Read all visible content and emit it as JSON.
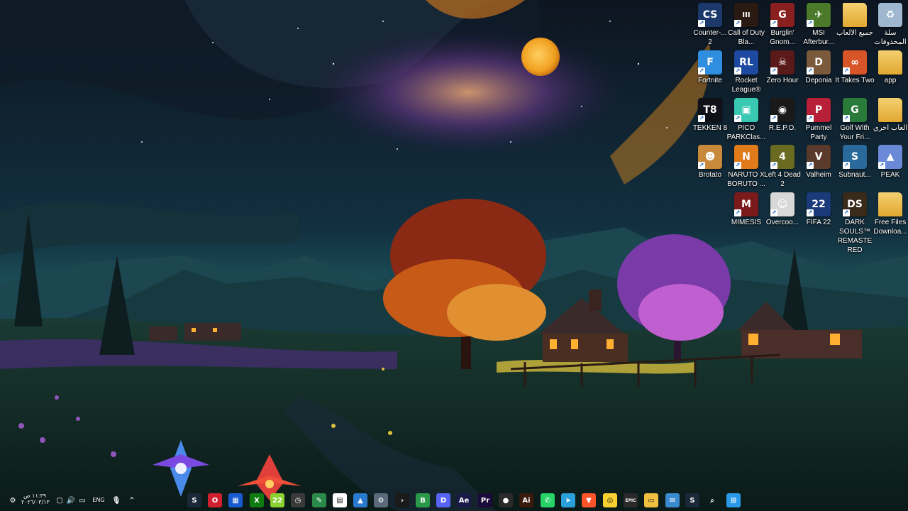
{
  "desktop": {
    "icons": [
      {
        "label": "Counter-...\n2",
        "icon": "counter-strike-icon",
        "color": "#1b3a6b",
        "glyph": "CS",
        "shortcut": true
      },
      {
        "label": "Call of Duty Bla...",
        "icon": "call-of-duty-icon",
        "color": "#2a1a12",
        "glyph": "III",
        "shortcut": true
      },
      {
        "label": "Burglin' Gnom...",
        "icon": "burglin-gnomes-icon",
        "color": "#8a1f1f",
        "glyph": "G",
        "shortcut": true
      },
      {
        "label": "MSI Afterbur...",
        "icon": "msi-afterburner-icon",
        "color": "#4a7a2a",
        "glyph": "✈",
        "shortcut": true
      },
      {
        "label": "جميع الالعاب",
        "icon": "folder-icon",
        "color": "#e8b84a",
        "glyph": "",
        "shortcut": false
      },
      {
        "label": "سلة المحذوفات",
        "icon": "recycle-bin-icon",
        "color": "#9fb8d0",
        "glyph": "♻",
        "shortcut": false
      },
      {
        "label": "Fortnite",
        "icon": "fortnite-icon",
        "color": "#2f8ee0",
        "glyph": "F",
        "shortcut": true
      },
      {
        "label": "Rocket League®",
        "icon": "rocket-league-icon",
        "color": "#1d4aa0",
        "glyph": "RL",
        "shortcut": true
      },
      {
        "label": "Zero Hour",
        "icon": "zero-hour-icon",
        "color": "#5a1a1a",
        "glyph": "☠",
        "shortcut": true
      },
      {
        "label": "Deponia",
        "icon": "deponia-icon",
        "color": "#7a5a3a",
        "glyph": "D",
        "shortcut": true
      },
      {
        "label": "It Takes Two",
        "icon": "it-takes-two-icon",
        "color": "#d8552a",
        "glyph": "∞",
        "shortcut": true
      },
      {
        "label": "app",
        "icon": "folder-icon",
        "color": "#e8b84a",
        "glyph": "",
        "shortcut": false
      },
      {
        "label": "TEKKEN 8",
        "icon": "tekken-8-icon",
        "color": "#101018",
        "glyph": "T8",
        "shortcut": true
      },
      {
        "label": "PICO PARKClas...",
        "icon": "pico-park-icon",
        "color": "#39c9b2",
        "glyph": "▣",
        "shortcut": true
      },
      {
        "label": "R.E.P.O.",
        "icon": "repo-icon",
        "color": "#1a1a1a",
        "glyph": "◉",
        "shortcut": true
      },
      {
        "label": "Pummel Party",
        "icon": "pummel-party-icon",
        "color": "#b8203a",
        "glyph": "P",
        "shortcut": true
      },
      {
        "label": "Golf With Your Fri...",
        "icon": "golf-with-your-friends-icon",
        "color": "#2a7a3a",
        "glyph": "G",
        "shortcut": true
      },
      {
        "label": "العاب اخري",
        "icon": "folder-icon",
        "color": "#e8b84a",
        "glyph": "",
        "shortcut": false
      },
      {
        "label": "Brotato",
        "icon": "brotato-icon",
        "color": "#c88a3a",
        "glyph": "☻",
        "shortcut": true
      },
      {
        "label": "NARUTO X BORUTO ...",
        "icon": "naruto-x-boruto-icon",
        "color": "#e07a1a",
        "glyph": "N",
        "shortcut": true
      },
      {
        "label": "Left 4 Dead 2",
        "icon": "left-4-dead-2-icon",
        "color": "#6a6a20",
        "glyph": "4",
        "shortcut": true
      },
      {
        "label": "Valheim",
        "icon": "valheim-icon",
        "color": "#5a3a2a",
        "glyph": "V",
        "shortcut": true
      },
      {
        "label": "Subnaut...",
        "icon": "subnautica-icon",
        "color": "#2a6a9a",
        "glyph": "S",
        "shortcut": true
      },
      {
        "label": "PEAK",
        "icon": "peak-icon",
        "color": "#6a8ad8",
        "glyph": "▲",
        "shortcut": true
      },
      {
        "label": "MIMESIS",
        "icon": "mimesis-icon",
        "color": "#7a1a1a",
        "glyph": "M",
        "shortcut": true
      },
      {
        "label": "Overcoo...",
        "icon": "overcooked-icon",
        "color": "#d8d8d8",
        "glyph": "☺",
        "shortcut": true
      },
      {
        "label": "FIFA 22",
        "icon": "fifa-22-icon",
        "color": "#1a3a7a",
        "glyph": "22",
        "shortcut": true
      },
      {
        "label": "DARK SOULS™ REMASTE RED",
        "icon": "dark-souls-icon",
        "color": "#3a2a1a",
        "glyph": "DS",
        "shortcut": true
      },
      {
        "label": "Free Files Downloa...",
        "icon": "folder-icon",
        "color": "#e8b84a",
        "glyph": "",
        "shortcut": false
      }
    ]
  },
  "taskbar": {
    "clock_time": "١١:٣٩ ص",
    "clock_date": "٢٠٢٦/٠٣/١٣",
    "language": "ENG",
    "tray_icons": [
      "settings-icon",
      "notification-icon",
      "volume-icon",
      "network-icon",
      "display-icon"
    ],
    "apps": [
      {
        "icon": "steam-icon",
        "color": "#1b2838",
        "glyph": "S"
      },
      {
        "icon": "opera-icon",
        "color": "#d02030",
        "glyph": "O"
      },
      {
        "icon": "app-blue-icon",
        "color": "#1a5ad0",
        "glyph": "▦"
      },
      {
        "icon": "xbox-icon",
        "color": "#107c10",
        "glyph": "X"
      },
      {
        "icon": "calendar-app-icon",
        "color": "#8ad030",
        "glyph": "22"
      },
      {
        "icon": "clock-app-icon",
        "color": "#3a3a3a",
        "glyph": "◷"
      },
      {
        "icon": "paint-icon",
        "color": "#2a8a4a",
        "glyph": "✎"
      },
      {
        "icon": "store-icon",
        "color": "#ffffff",
        "glyph": "▤"
      },
      {
        "icon": "photos-icon",
        "color": "#2a7ad0",
        "glyph": "▲"
      },
      {
        "icon": "settings-app-icon",
        "color": "#5a6a7a",
        "glyph": "⚙"
      },
      {
        "icon": "terminal-icon",
        "color": "#1a1a1a",
        "glyph": "›"
      },
      {
        "icon": "b-app-icon",
        "color": "#2a9a4a",
        "glyph": "B"
      },
      {
        "icon": "discord-icon",
        "color": "#5865f2",
        "glyph": "D"
      },
      {
        "icon": "after-effects-icon",
        "color": "#1a1a4a",
        "glyph": "Ae"
      },
      {
        "icon": "premiere-icon",
        "color": "#1a0a3a",
        "glyph": "Pr"
      },
      {
        "icon": "obs-icon",
        "color": "#2a2a2a",
        "glyph": "●"
      },
      {
        "icon": "illustrator-icon",
        "color": "#3a1a0a",
        "glyph": "Ai"
      },
      {
        "icon": "whatsapp-icon",
        "color": "#25d366",
        "glyph": "✆"
      },
      {
        "icon": "telegram-icon",
        "color": "#2aa1da",
        "glyph": "➤"
      },
      {
        "icon": "brave-icon",
        "color": "#fb542b",
        "glyph": "▼"
      },
      {
        "icon": "snap-icon",
        "color": "#f8d030",
        "glyph": "◎"
      },
      {
        "icon": "epic-games-icon",
        "color": "#2a2a2a",
        "glyph": "EPIC"
      },
      {
        "icon": "file-explorer-icon",
        "color": "#f0c040",
        "glyph": "▭"
      },
      {
        "icon": "mail-icon",
        "color": "#3a8ad0",
        "glyph": "✉"
      },
      {
        "icon": "steam-icon",
        "color": "#1b2838",
        "glyph": "S"
      },
      {
        "icon": "search-icon",
        "color": "transparent",
        "glyph": "⌕"
      },
      {
        "icon": "start-icon",
        "color": "#2a9ae8",
        "glyph": "⊞"
      }
    ]
  }
}
